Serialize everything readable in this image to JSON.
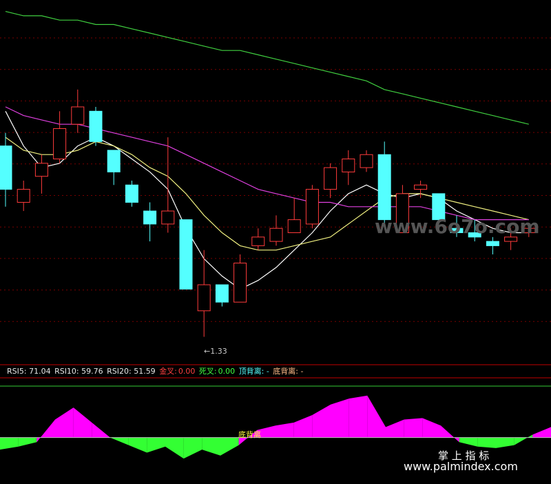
{
  "colors": {
    "background": "#000000",
    "up": "#ff3b3b",
    "down": "#54ffff",
    "ma_short": "#ffffff",
    "ma_mid": "#f0f080",
    "ma_long": "#e040e0",
    "ma_longest": "#40d040",
    "rsi_pos": "#ff00ff",
    "rsi_neg": "#33ff33",
    "grid": "#7a0000"
  },
  "indicator": {
    "rsi5": "RSI5: 71.04",
    "rsi10": "RSI10: 59.76",
    "rsi20": "RSI20: 51.59",
    "golden_label": "金叉:",
    "golden_value": "0.00",
    "death_label": "死叉:",
    "death_value": "0.00",
    "top_div": "顶背离: -",
    "bottom_div": "底背离: -"
  },
  "annotations": {
    "low_label": "←1.33",
    "divergence_label": "底背离"
  },
  "watermarks": {
    "site_mark": "www.6o7o.com",
    "cn_text": "掌 上 指 标",
    "url": "www.palmindex.com"
  },
  "chart_data": [
    {
      "type": "candlestick",
      "low_marker": 1.33,
      "candles": [
        {
          "o": 1.77,
          "c": 1.67,
          "h": 1.8,
          "l": 1.63
        },
        {
          "o": 1.64,
          "c": 1.67,
          "h": 1.69,
          "l": 1.62
        },
        {
          "o": 1.7,
          "c": 1.73,
          "h": 1.75,
          "l": 1.66
        },
        {
          "o": 1.74,
          "c": 1.81,
          "h": 1.85,
          "l": 1.73
        },
        {
          "o": 1.82,
          "c": 1.86,
          "h": 1.9,
          "l": 1.8
        },
        {
          "o": 1.85,
          "c": 1.78,
          "h": 1.86,
          "l": 1.77
        },
        {
          "o": 1.76,
          "c": 1.71,
          "h": 1.76,
          "l": 1.68
        },
        {
          "o": 1.68,
          "c": 1.64,
          "h": 1.69,
          "l": 1.63
        },
        {
          "o": 1.62,
          "c": 1.59,
          "h": 1.64,
          "l": 1.55
        },
        {
          "o": 1.59,
          "c": 1.62,
          "h": 1.79,
          "l": 1.57
        },
        {
          "o": 1.6,
          "c": 1.44,
          "h": 1.6,
          "l": 1.44
        },
        {
          "o": 1.39,
          "c": 1.45,
          "h": 1.53,
          "l": 1.33
        },
        {
          "o": 1.45,
          "c": 1.41,
          "h": 1.45,
          "l": 1.4
        },
        {
          "o": 1.41,
          "c": 1.5,
          "h": 1.52,
          "l": 1.41
        },
        {
          "o": 1.54,
          "c": 1.56,
          "h": 1.58,
          "l": 1.53
        },
        {
          "o": 1.55,
          "c": 1.58,
          "h": 1.61,
          "l": 1.54
        },
        {
          "o": 1.57,
          "c": 1.6,
          "h": 1.65,
          "l": 1.57
        },
        {
          "o": 1.59,
          "c": 1.67,
          "h": 1.68,
          "l": 1.58
        },
        {
          "o": 1.67,
          "c": 1.72,
          "h": 1.73,
          "l": 1.65
        },
        {
          "o": 1.71,
          "c": 1.74,
          "h": 1.76,
          "l": 1.68
        },
        {
          "o": 1.72,
          "c": 1.75,
          "h": 1.76,
          "l": 1.71
        },
        {
          "o": 1.75,
          "c": 1.6,
          "h": 1.78,
          "l": 1.59
        },
        {
          "o": 1.57,
          "c": 1.66,
          "h": 1.68,
          "l": 1.57
        },
        {
          "o": 1.67,
          "c": 1.68,
          "h": 1.69,
          "l": 1.65
        },
        {
          "o": 1.66,
          "c": 1.6,
          "h": 1.66,
          "l": 1.59
        },
        {
          "o": 1.58,
          "c": 1.57,
          "h": 1.61,
          "l": 1.56
        },
        {
          "o": 1.57,
          "c": 1.56,
          "h": 1.6,
          "l": 1.55
        },
        {
          "o": 1.55,
          "c": 1.54,
          "h": 1.56,
          "l": 1.52
        },
        {
          "o": 1.55,
          "c": 1.56,
          "h": 1.58,
          "l": 1.53
        },
        {
          "o": 1.57,
          "c": 1.58,
          "h": 1.59,
          "l": 1.56
        }
      ],
      "moving_averages": [
        {
          "color_key": "ma_short",
          "values": [
            1.85,
            1.77,
            1.72,
            1.73,
            1.77,
            1.79,
            1.77,
            1.74,
            1.71,
            1.67,
            1.58,
            1.51,
            1.47,
            1.44,
            1.46,
            1.49,
            1.53,
            1.57,
            1.62,
            1.66,
            1.68,
            1.66,
            1.65,
            1.66,
            1.65,
            1.62,
            1.6,
            1.58,
            1.57,
            1.57
          ]
        },
        {
          "color_key": "ma_mid",
          "values": [
            1.79,
            1.76,
            1.75,
            1.75,
            1.76,
            1.78,
            1.77,
            1.75,
            1.72,
            1.7,
            1.66,
            1.61,
            1.57,
            1.54,
            1.53,
            1.53,
            1.54,
            1.55,
            1.56,
            1.59,
            1.62,
            1.65,
            1.66,
            1.66,
            1.65,
            1.64,
            1.63,
            1.62,
            1.61,
            1.6
          ]
        },
        {
          "color_key": "ma_long",
          "values": [
            1.86,
            1.84,
            1.83,
            1.82,
            1.82,
            1.81,
            1.8,
            1.79,
            1.78,
            1.77,
            1.75,
            1.73,
            1.71,
            1.69,
            1.67,
            1.66,
            1.65,
            1.64,
            1.64,
            1.63,
            1.63,
            1.63,
            1.63,
            1.63,
            1.62,
            1.61,
            1.6,
            1.6,
            1.6,
            1.6
          ]
        },
        {
          "color_key": "ma_longest",
          "values": [
            2.08,
            2.07,
            2.07,
            2.06,
            2.06,
            2.05,
            2.05,
            2.04,
            2.03,
            2.02,
            2.01,
            2.0,
            1.99,
            1.99,
            1.98,
            1.97,
            1.96,
            1.95,
            1.94,
            1.93,
            1.92,
            1.9,
            1.89,
            1.88,
            1.87,
            1.86,
            1.85,
            1.84,
            1.83,
            1.82
          ]
        }
      ],
      "ylim": [
        1.28,
        2.1
      ]
    },
    {
      "type": "area",
      "baseline": 0,
      "values": [
        -8,
        -6,
        -3,
        12,
        20,
        10,
        0,
        -5,
        -10,
        -6,
        -14,
        -8,
        -12,
        -5,
        5,
        8,
        10,
        15,
        22,
        26,
        28,
        7,
        12,
        13,
        8,
        -3,
        -6,
        -7,
        -5,
        2,
        7
      ],
      "ylim": [
        -30,
        32
      ]
    }
  ]
}
